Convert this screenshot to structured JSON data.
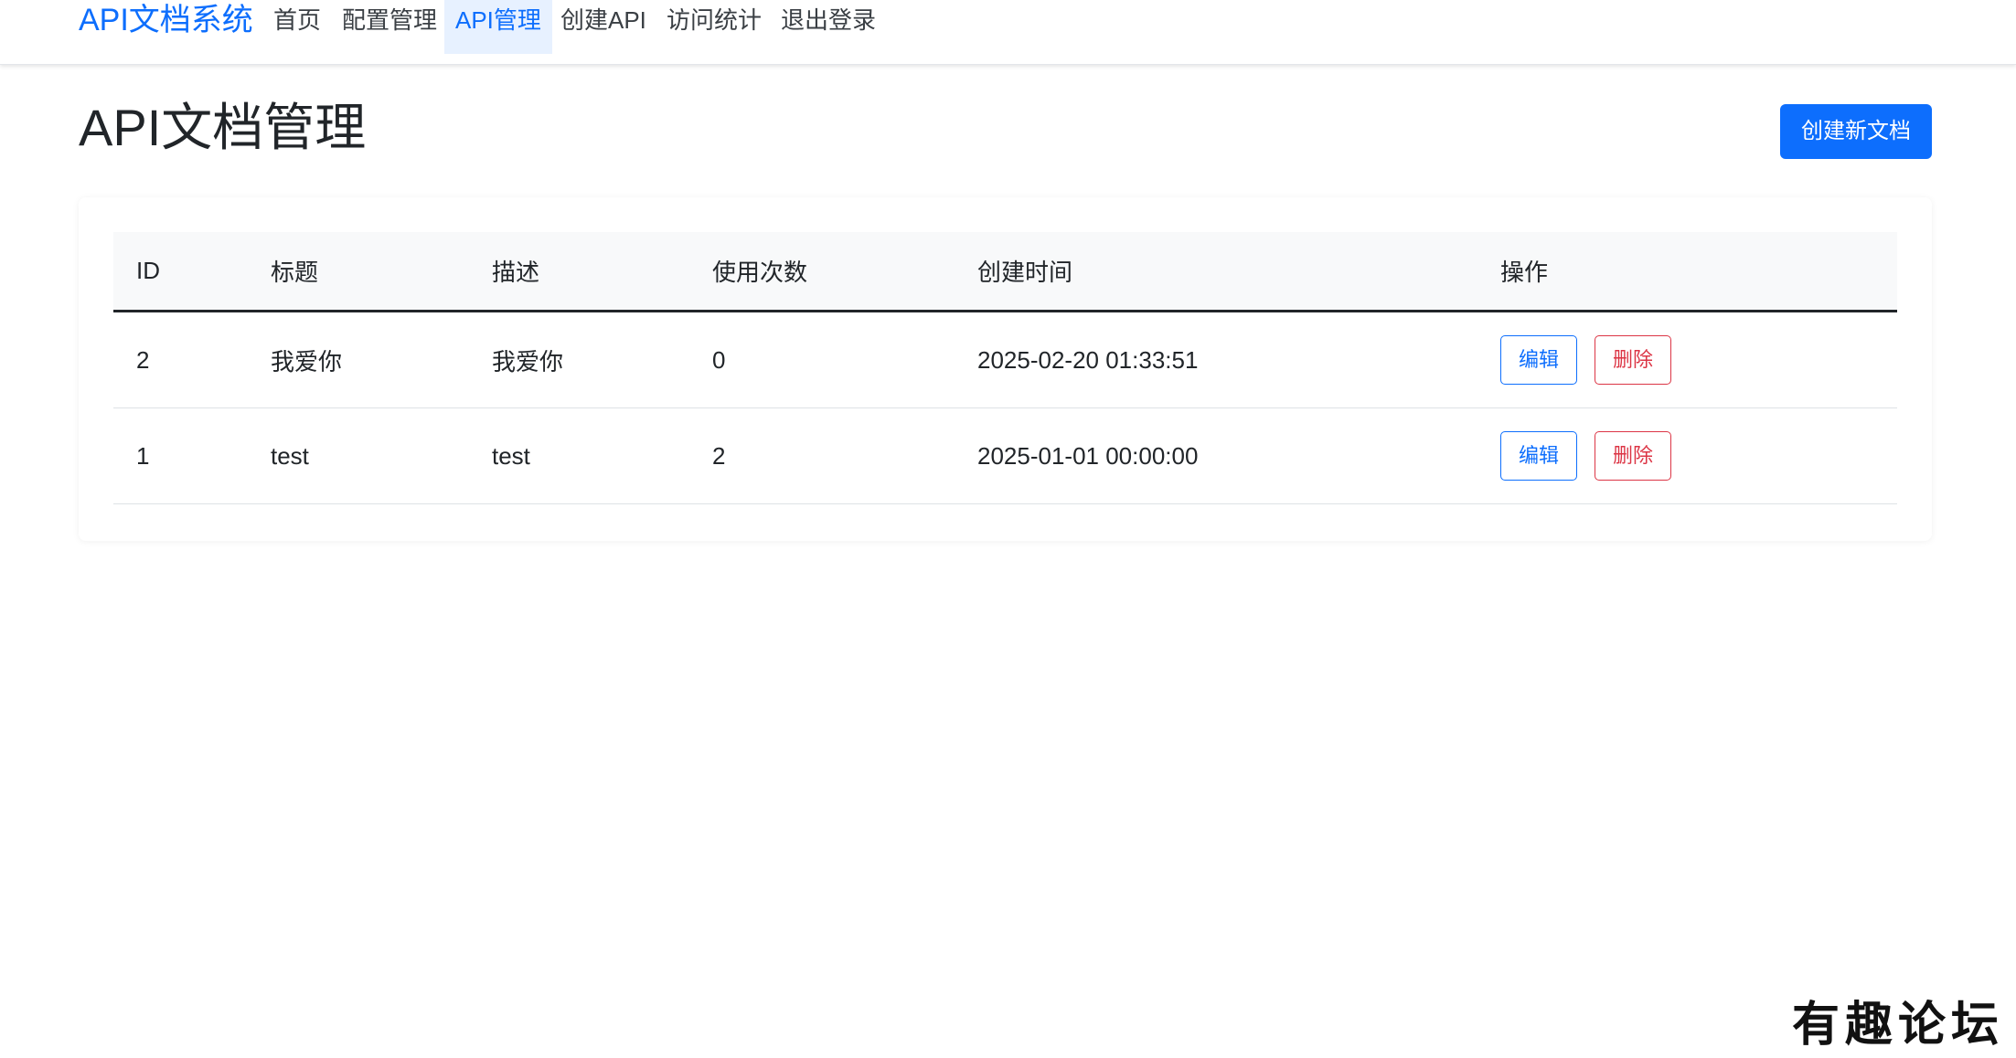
{
  "navbar": {
    "brand": "API文档系统",
    "links": [
      {
        "label": "首页",
        "active": false
      },
      {
        "label": "配置管理",
        "active": false
      },
      {
        "label": "API管理",
        "active": true
      },
      {
        "label": "创建API",
        "active": false
      },
      {
        "label": "访问统计",
        "active": false
      },
      {
        "label": "退出登录",
        "active": false
      }
    ]
  },
  "header": {
    "title": "API文档管理",
    "create_button": "创建新文档"
  },
  "table": {
    "columns": [
      "ID",
      "标题",
      "描述",
      "使用次数",
      "创建时间",
      "操作"
    ],
    "rows": [
      {
        "id": "2",
        "title": "我爱你",
        "description": "我爱你",
        "usage_count": "0",
        "created_at": "2025-02-20 01:33:51",
        "edit": "编辑",
        "delete": "删除"
      },
      {
        "id": "1",
        "title": "test",
        "description": "test",
        "usage_count": "2",
        "created_at": "2025-01-01 00:00:00",
        "edit": "编辑",
        "delete": "删除"
      }
    ]
  },
  "watermark": "有趣论坛",
  "colors": {
    "primary": "#0d6efd",
    "danger": "#dc3545",
    "active_nav_bg": "#e7f1ff",
    "table_header_bg": "#f8f9fa"
  }
}
